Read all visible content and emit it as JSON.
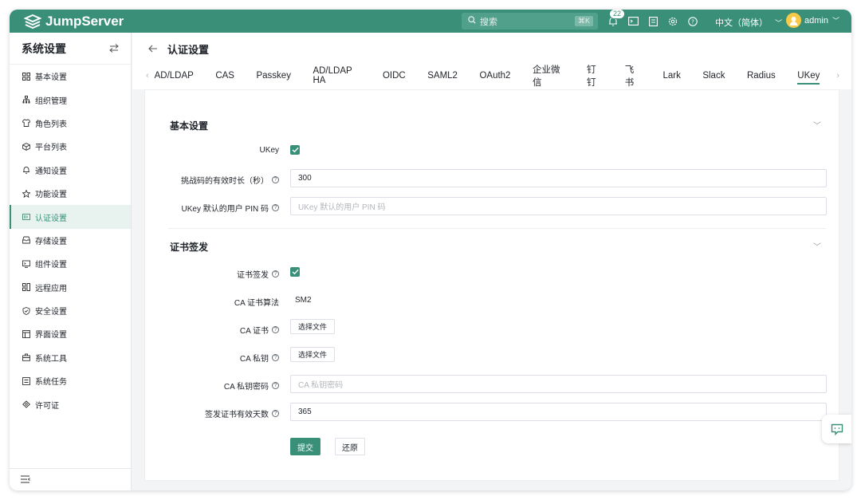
{
  "app": {
    "name": "JumpServer"
  },
  "topbar": {
    "search_placeholder": "搜索",
    "search_shortcut": "⌘K",
    "notification_count": "22",
    "language": "中文（简体）",
    "username": "admin",
    "icons": [
      "bell-icon",
      "terminal-icon",
      "clipboard-icon",
      "gear-icon",
      "help-icon"
    ]
  },
  "sidebar": {
    "title": "系统设置",
    "items": [
      {
        "label": "基本设置",
        "icon": "grid-icon"
      },
      {
        "label": "组织管理",
        "icon": "org-icon"
      },
      {
        "label": "角色列表",
        "icon": "shirt-icon"
      },
      {
        "label": "平台列表",
        "icon": "cube-icon"
      },
      {
        "label": "通知设置",
        "icon": "bell-icon"
      },
      {
        "label": "功能设置",
        "icon": "star-icon"
      },
      {
        "label": "认证设置",
        "icon": "id-card-icon",
        "active": true
      },
      {
        "label": "存储设置",
        "icon": "storage-icon"
      },
      {
        "label": "组件设置",
        "icon": "component-icon"
      },
      {
        "label": "远程应用",
        "icon": "apps-icon"
      },
      {
        "label": "安全设置",
        "icon": "shield-icon"
      },
      {
        "label": "界面设置",
        "icon": "layout-icon"
      },
      {
        "label": "系统工具",
        "icon": "toolbox-icon"
      },
      {
        "label": "系统任务",
        "icon": "tasks-icon"
      },
      {
        "label": "许可证",
        "icon": "license-icon"
      }
    ]
  },
  "page": {
    "title": "认证设置",
    "tabs": [
      "AD/LDAP",
      "CAS",
      "Passkey",
      "AD/LDAP HA",
      "OIDC",
      "SAML2",
      "OAuth2",
      "企业微信",
      "钉钉",
      "飞书",
      "Lark",
      "Slack",
      "Radius",
      "UKey"
    ],
    "active_tab": "UKey"
  },
  "form": {
    "basic": {
      "title": "基本设置",
      "ukey_label": "UKey",
      "ukey_enabled": true,
      "challenge_label": "挑战码的有效时长（秒）",
      "challenge_value": "300",
      "pin_label": "UKey 默认的用户 PIN 码",
      "pin_placeholder": "UKey 默认的用户 PIN 码"
    },
    "cert": {
      "title": "证书签发",
      "issue_label": "证书签发",
      "issue_enabled": true,
      "algo_label": "CA 证书算法",
      "algo_value": "SM2",
      "ca_cert_label": "CA 证书",
      "ca_key_label": "CA 私钥",
      "choose_file": "选择文件",
      "ca_key_pwd_label": "CA 私钥密码",
      "ca_key_pwd_placeholder": "CA 私钥密码",
      "validity_label": "签发证书有效天数",
      "validity_value": "365"
    },
    "submit_label": "提交",
    "reset_label": "还原"
  },
  "colors": {
    "brand": "#3a8f78",
    "active_bg": "#e8f3f0"
  }
}
